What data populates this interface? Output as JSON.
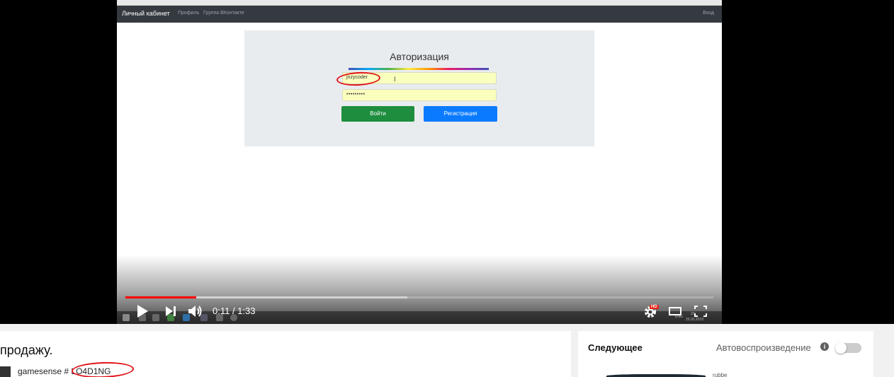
{
  "site_nav": {
    "brand": "Личный кабинет",
    "links": [
      "Профиль",
      "Группа ВКонтакте"
    ],
    "login": "Вход"
  },
  "auth": {
    "title": "Авторизация",
    "login_value": "jnzycoder",
    "password_value": "•••••••••",
    "login_button": "Войти",
    "register_button": "Регистрация"
  },
  "player": {
    "time": "0:11 / 1:33",
    "played_fraction": 0.12,
    "buffered_fraction": 0.48,
    "hd_badge": "HD",
    "taskbar_tray": [
      "ENG",
      "22:",
      "25.02.2019"
    ]
  },
  "video": {
    "title": "продажу.",
    "channel_name": "gamesense #",
    "channel_tag": "LO4D1NG"
  },
  "sidebar": {
    "up_next": "Следующее",
    "autoplay": "Автовоспроизведение",
    "peek_text": "rubbe"
  },
  "colors": {
    "progress": "#ff0000",
    "login_button": "#1e8e3e",
    "register_button": "#0a7bff",
    "annotation_circle": "#e0141a"
  }
}
